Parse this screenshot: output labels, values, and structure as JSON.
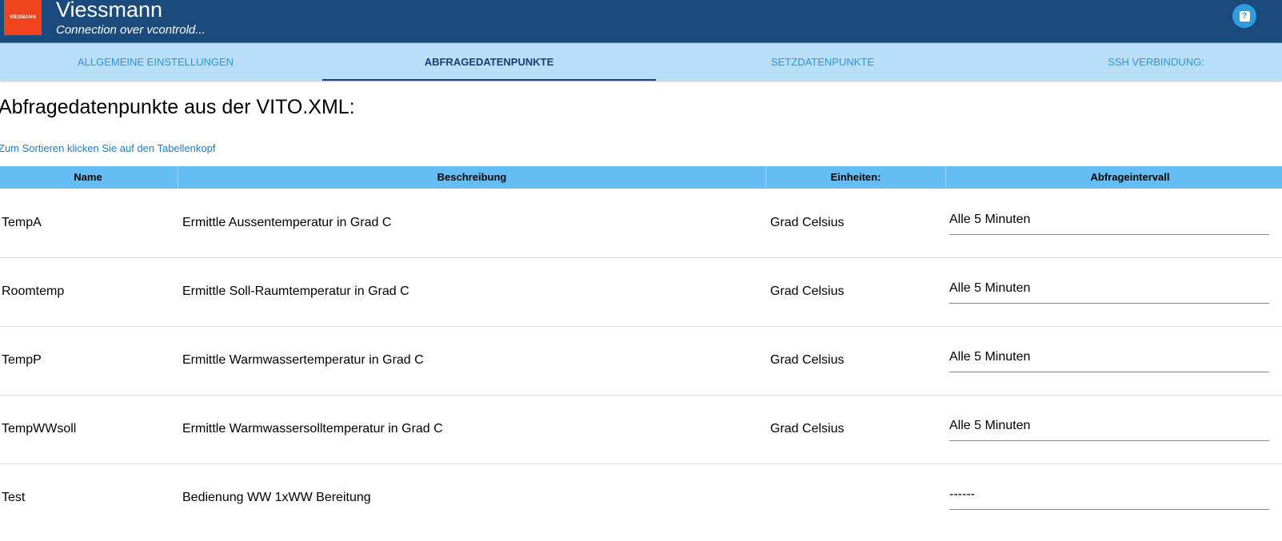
{
  "header": {
    "logo_text": "VIESMANN",
    "title": "Viessmann",
    "subtitle": "Connection over vcontrold...",
    "help_icon": "help-icon",
    "brand_color": "#f0421c"
  },
  "tabs": [
    {
      "label": "ALLGEMEINE EINSTELLUNGEN",
      "active": false
    },
    {
      "label": "ABFRAGEDATENPUNKTE",
      "active": true
    },
    {
      "label": "SETZDATENPUNKTE",
      "active": false
    },
    {
      "label": "SSH VERBINDUNG:",
      "active": false
    }
  ],
  "main": {
    "title": "Abfragedatenpunkte aus der VITO.XML:",
    "sort_hint": "Zum Sortieren klicken Sie auf den Tabellenkopf",
    "columns": [
      "Name",
      "Beschreibung",
      "Einheiten:",
      "Abfrageintervall"
    ],
    "rows": [
      {
        "name": "TempA",
        "description": "Ermittle Aussentemperatur in Grad C",
        "unit": "Grad Celsius",
        "interval": "Alle 5 Minuten"
      },
      {
        "name": "Roomtemp",
        "description": "Ermittle Soll-Raumtemperatur in Grad C",
        "unit": "Grad Celsius",
        "interval": "Alle 5 Minuten"
      },
      {
        "name": "TempP",
        "description": "Ermittle Warmwassertemperatur in Grad C",
        "unit": "Grad Celsius",
        "interval": "Alle 5 Minuten"
      },
      {
        "name": "TempWWsoll",
        "description": "Ermittle Warmwassersolltemperatur in Grad C",
        "unit": "Grad Celsius",
        "interval": "Alle 5 Minuten"
      },
      {
        "name": "Test",
        "description": "Bedienung WW 1xWW Bereitung",
        "unit": "",
        "interval": "------"
      }
    ]
  }
}
